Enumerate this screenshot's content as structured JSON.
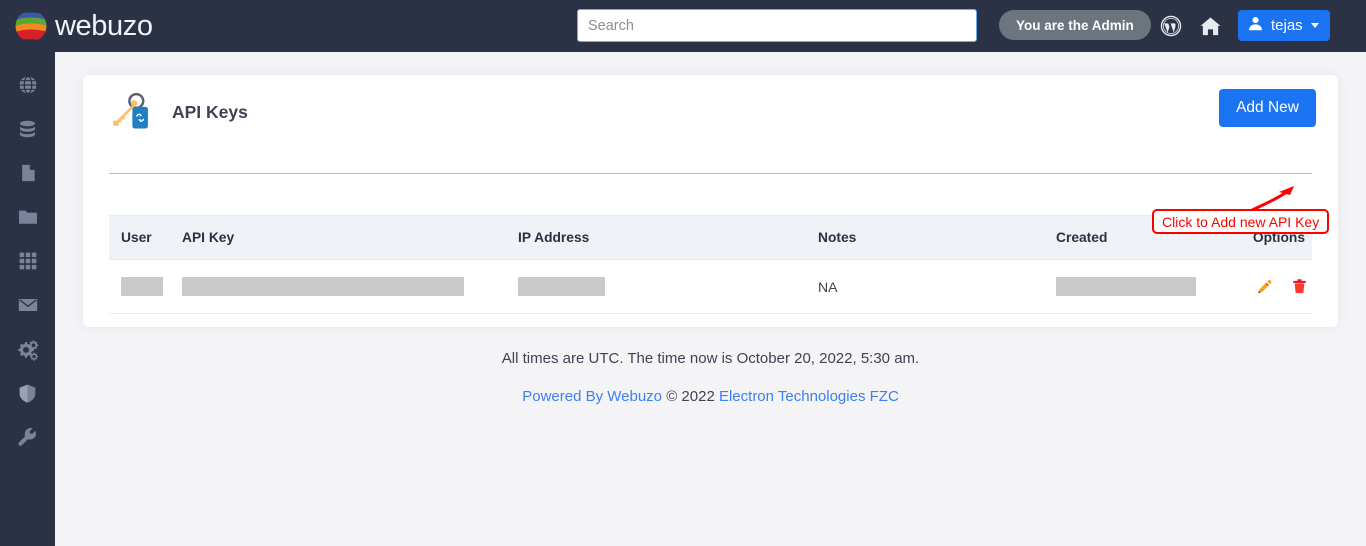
{
  "header": {
    "brand_name": "webuzo",
    "brand_logo_icon": "webuzo-sphere-logo",
    "search": {
      "placeholder": "Search",
      "value": ""
    },
    "admin_badge": "You are the Admin",
    "wordpress_icon": "wordpress-icon",
    "home_icon": "home-icon",
    "user": {
      "avatar_icon": "user-avatar-icon",
      "name": "tejas",
      "caret_icon": "chevron-down-icon"
    }
  },
  "sidebar": {
    "items": [
      {
        "icon": "globe-icon",
        "name": "domains"
      },
      {
        "icon": "database-icon",
        "name": "databases"
      },
      {
        "icon": "file-icon",
        "name": "files"
      },
      {
        "icon": "folder-icon",
        "name": "folders"
      },
      {
        "icon": "grid-icon",
        "name": "apps"
      },
      {
        "icon": "envelope-icon",
        "name": "email"
      },
      {
        "icon": "gears-icon",
        "name": "settings"
      },
      {
        "icon": "shield-icon",
        "name": "security"
      },
      {
        "icon": "wrench-icon",
        "name": "tools"
      }
    ]
  },
  "card": {
    "icon": "api-key-icon",
    "title": "API Keys",
    "add_button": "Add New"
  },
  "callout": {
    "text": "Click to Add new API Key",
    "border_color": "#ff0000",
    "text_color": "#ff0000"
  },
  "table": {
    "columns": [
      "User",
      "API Key",
      "IP Address",
      "Notes",
      "Created",
      "Options"
    ],
    "rows": [
      {
        "user": "",
        "user_redacted": true,
        "api_key": "",
        "api_key_redacted": true,
        "ip_address": "",
        "ip_redacted": true,
        "notes": "NA",
        "created": "",
        "created_redacted": true,
        "options": [
          "edit-icon",
          "delete-icon"
        ]
      }
    ]
  },
  "footer": {
    "time_notice": "All times are UTC. The time now is October 20, 2022, 5:30 am.",
    "powered_by": "Powered By Webuzo",
    "copyright": " © 2022 ",
    "company": "Electron Technologies FZC"
  },
  "colors": {
    "sidebar_bg": "#2b3245",
    "header_bg": "#2b3245",
    "accent_blue": "#1a73f0",
    "page_bg": "#f4f4f7",
    "table_head_bg": "#eff2f7",
    "redaction_gray": "#c9c9c9",
    "edit_icon": "#f7941e",
    "delete_icon": "#ec1c24",
    "link_blue": "#3c7ff0"
  }
}
